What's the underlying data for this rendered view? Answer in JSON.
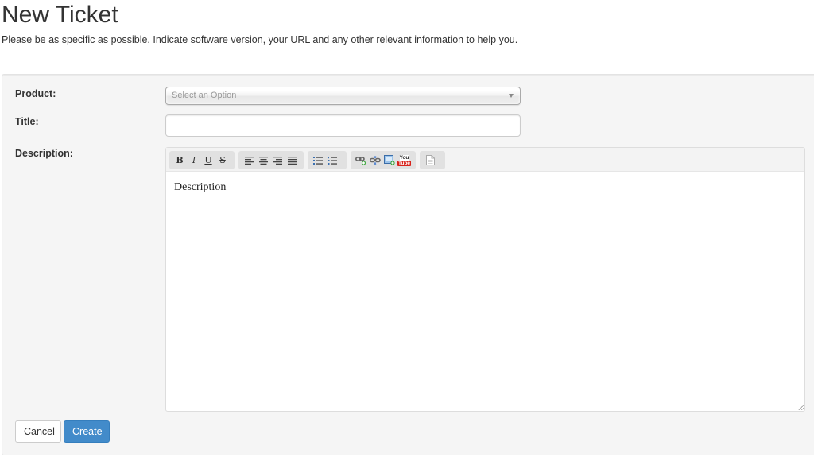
{
  "page": {
    "title": "New Ticket",
    "subtitle": "Please be as specific as possible. Indicate software version, your URL and any other relevant information to help you."
  },
  "form": {
    "product": {
      "label": "Product:",
      "placeholder": "Select an Option",
      "value": ""
    },
    "title": {
      "label": "Title:",
      "value": ""
    },
    "description": {
      "label": "Description:",
      "content": "Description",
      "toolbar": {
        "groups": [
          {
            "name": "text-style",
            "buttons": [
              {
                "icon": "bold-icon",
                "glyph": "B"
              },
              {
                "icon": "italic-icon",
                "glyph": "I"
              },
              {
                "icon": "underline-icon",
                "glyph": "U"
              },
              {
                "icon": "strikethrough-icon",
                "glyph": "S"
              }
            ]
          },
          {
            "name": "alignment",
            "buttons": [
              {
                "icon": "align-left-icon"
              },
              {
                "icon": "align-center-icon"
              },
              {
                "icon": "align-right-icon"
              },
              {
                "icon": "align-justify-icon"
              }
            ]
          },
          {
            "name": "lists",
            "buttons": [
              {
                "icon": "bulleted-list-icon"
              },
              {
                "icon": "numbered-list-icon"
              }
            ]
          },
          {
            "name": "insert",
            "buttons": [
              {
                "icon": "insert-link-icon"
              },
              {
                "icon": "remove-link-icon"
              },
              {
                "icon": "insert-image-icon"
              },
              {
                "icon": "youtube-icon",
                "text_top": "You",
                "text_bottom": "Tube"
              }
            ]
          },
          {
            "name": "source",
            "buttons": [
              {
                "icon": "view-source-icon"
              }
            ]
          }
        ]
      }
    },
    "buttons": {
      "cancel": "Cancel",
      "create": "Create"
    }
  },
  "colors": {
    "primary": "#428bca",
    "panel_bg": "#f5f5f5"
  }
}
